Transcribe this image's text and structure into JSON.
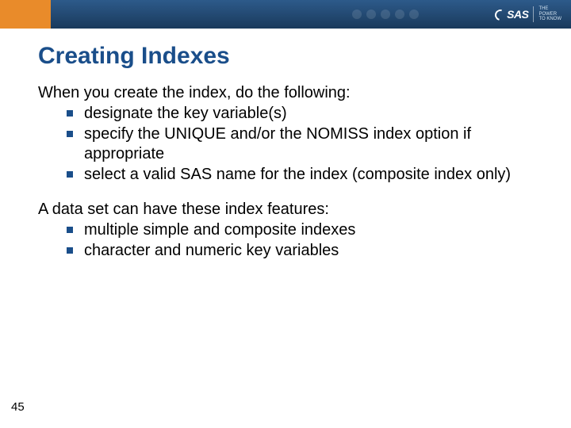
{
  "header": {
    "logo_text": "SAS",
    "tagline_line1": "THE",
    "tagline_line2": "POWER",
    "tagline_line3": "TO KNOW"
  },
  "slide": {
    "title": "Creating Indexes",
    "section1": {
      "lead": "When you create the index, do the following:",
      "items": [
        "designate the key variable(s)",
        "specify the UNIQUE and/or the NOMISS index option if appropriate",
        "select a valid SAS name for the index (composite index only)"
      ]
    },
    "section2": {
      "lead": "A data set can have these index features:",
      "items": [
        "multiple simple and composite indexes",
        "character and numeric key variables"
      ]
    }
  },
  "page_number": "45"
}
